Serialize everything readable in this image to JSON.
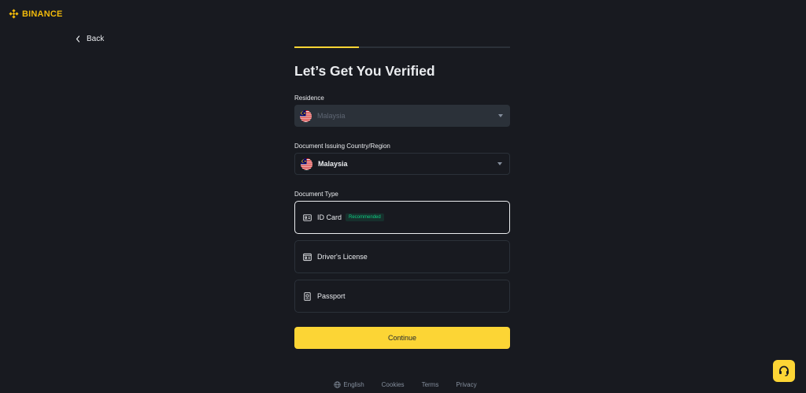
{
  "brand": {
    "name": "BINANCE",
    "color": "#f0b90b"
  },
  "nav": {
    "back_label": "Back"
  },
  "progress": {
    "fraction": 0.3
  },
  "page_title": "Let’s Get You Verified",
  "residence": {
    "label": "Residence",
    "value": "Malaysia",
    "flag_icon": "malaysia-flag-icon",
    "disabled": true
  },
  "issuing_country": {
    "label": "Document Issuing Country/Region",
    "value": "Malaysia",
    "flag_icon": "malaysia-flag-icon"
  },
  "document_type": {
    "label": "Document Type",
    "options": [
      {
        "label": "ID Card",
        "icon": "id-card-icon",
        "badge": "Recommended",
        "selected": true
      },
      {
        "label": "Driver's License",
        "icon": "drivers-license-icon",
        "selected": false
      },
      {
        "label": "Passport",
        "icon": "passport-icon",
        "selected": false
      }
    ]
  },
  "continue_label": "Continue",
  "footer": {
    "language": "English",
    "links": [
      "Cookies",
      "Terms",
      "Privacy"
    ]
  },
  "colors": {
    "background": "#181a20",
    "accent": "#fcd535",
    "badge_green": "#0ecb81"
  }
}
